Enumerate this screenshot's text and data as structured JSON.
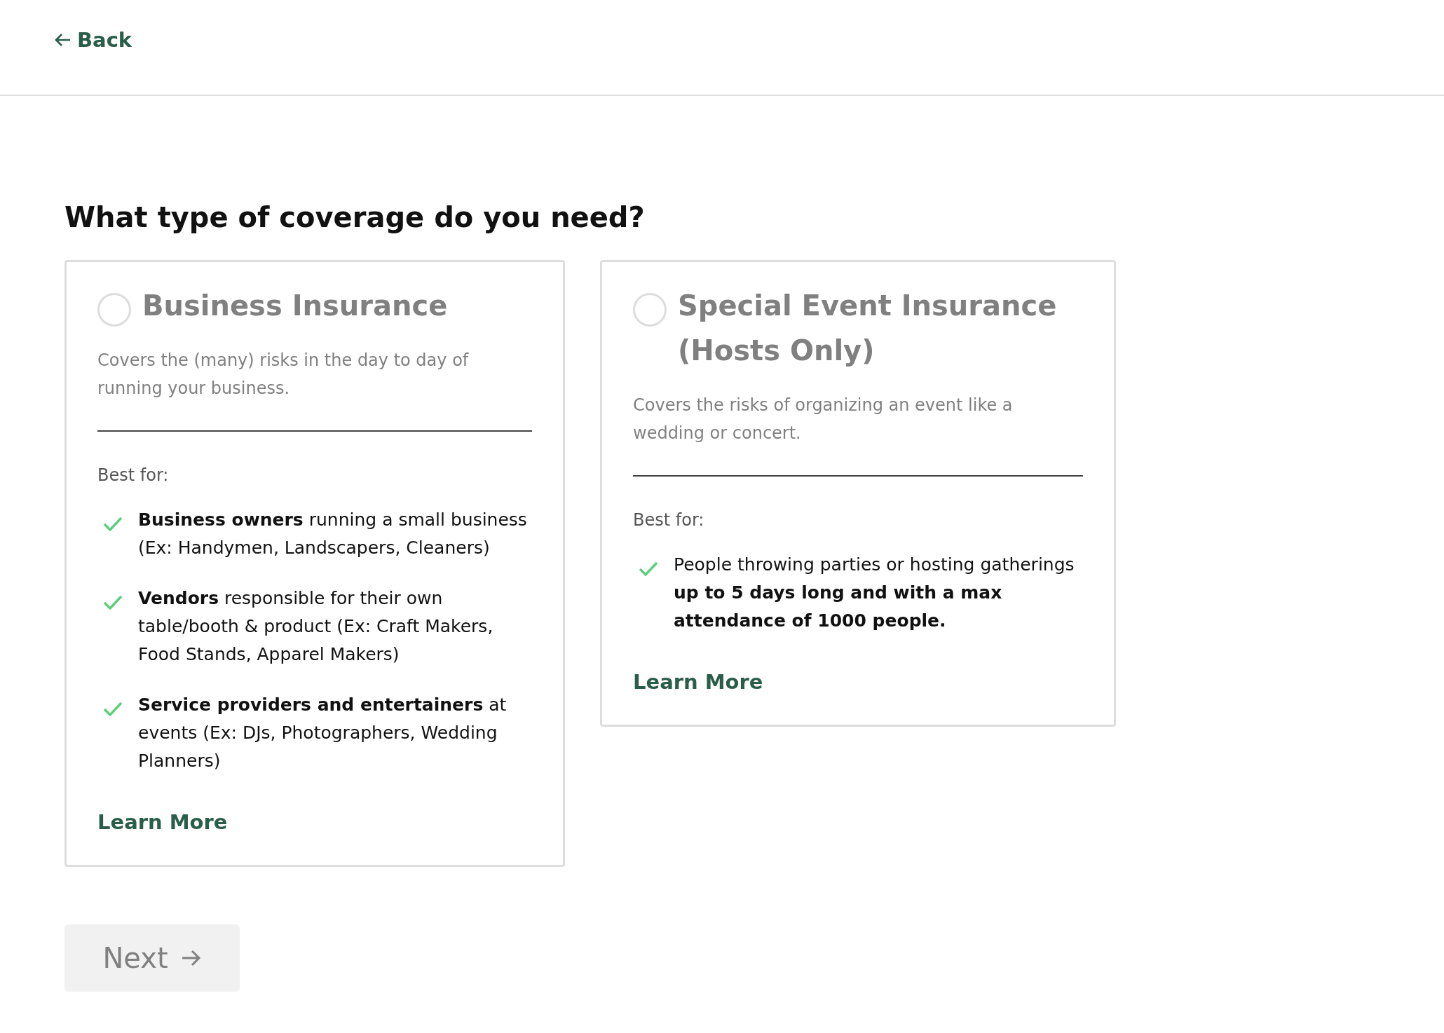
{
  "header": {
    "back_link": "Back"
  },
  "heading": "What type of coverage do you need?",
  "options": [
    {
      "title": "Business Insurance",
      "selected": false,
      "description": "Covers the (many) risks in the day to day of running your business.",
      "best_for_label": "Best for:",
      "items": [
        "**Business owners** running a small business (Ex: Handymen, Landscapers, Cleaners)",
        "**Vendors** responsible for their own table/booth & product (Ex: Craft Makers, Food Stands, Apparel Makers)",
        "**Service providers and entertainers** at events (Ex: DJs, Photographers, Wedding Planners)"
      ],
      "link": "Learn More"
    },
    {
      "title": "Special Event Insurance (Hosts Only)",
      "selected": false,
      "description": "Covers the risks of organizing an event like a wedding or concert.",
      "best_for_label": "Best for:",
      "items": [
        "People throwing parties or hosting gatherings **up to 5 days long and with a max attendance of 1000 people.**"
      ],
      "link": "Learn More"
    }
  ],
  "next_button": {
    "label": "Next",
    "disabled": true
  }
}
